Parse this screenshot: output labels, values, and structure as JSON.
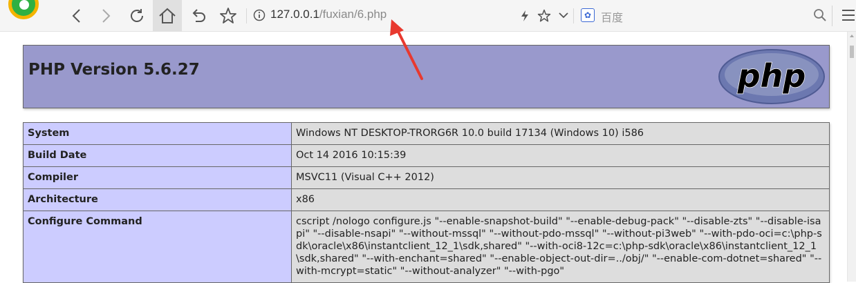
{
  "browser": {
    "url_host": "127.0.0.1",
    "url_path": "/fuxian/6.php",
    "search_placeholder": "百度",
    "search_engine_icon": "paw-icon",
    "accent_color": "#3a68d4"
  },
  "php_info": {
    "title": "PHP Version 5.6.27",
    "logo_text": "php",
    "header_color": "#9999cc",
    "label_color": "#ccccff",
    "value_color": "#dddddd",
    "rows": [
      {
        "label": "System",
        "value": "Windows NT DESKTOP-TRORG6R 10.0 build 17134 (Windows 10) i586"
      },
      {
        "label": "Build Date",
        "value": "Oct 14 2016 10:15:39"
      },
      {
        "label": "Compiler",
        "value": "MSVC11 (Visual C++ 2012)"
      },
      {
        "label": "Architecture",
        "value": "x86"
      },
      {
        "label": "Configure Command",
        "value": "cscript /nologo configure.js \"--enable-snapshot-build\" \"--enable-debug-pack\" \"--disable-zts\" \"--disable-isapi\" \"--disable-nsapi\" \"--without-mssql\" \"--without-pdo-mssql\" \"--without-pi3web\" \"--with-pdo-oci=c:\\php-sdk\\oracle\\x86\\instantclient_12_1\\sdk,shared\" \"--with-oci8-12c=c:\\php-sdk\\oracle\\x86\\instantclient_12_1\\sdk,shared\" \"--with-enchant=shared\" \"--enable-object-out-dir=../obj/\" \"--enable-com-dotnet=shared\" \"--with-mcrypt=static\" \"--without-analyzer\" \"--with-pgo\""
      }
    ]
  },
  "annotation": {
    "arrow_color": "#e8392f"
  }
}
